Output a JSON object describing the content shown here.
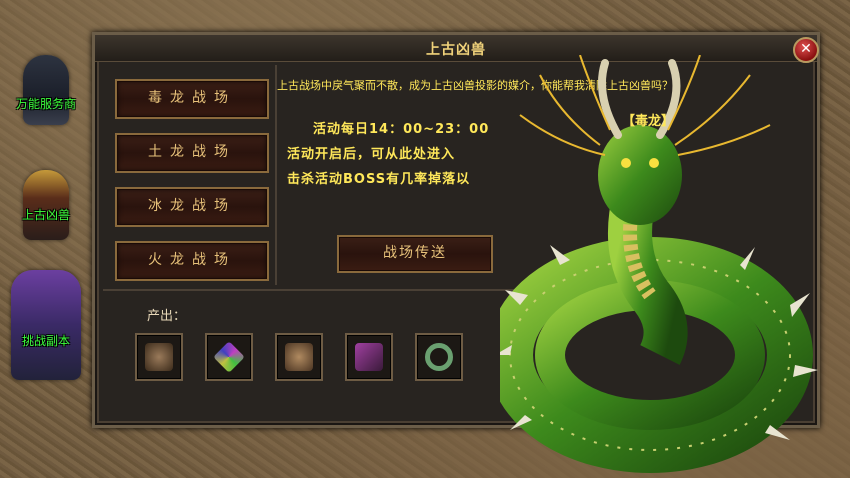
{
  "npcs": [
    {
      "label": "万能服务商"
    },
    {
      "label": "上古凶兽"
    },
    {
      "label": "挑战副本"
    }
  ],
  "dialog": {
    "title": "上古凶兽",
    "close_symbol": "✕",
    "description": "上古战场中戾气聚而不散，成为上古凶兽投影的媒介，你能帮我清除上古凶兽吗？",
    "schedule": "活动每日14：00~23：00",
    "line2": "活动开启后，可从此处进入",
    "line3": "击杀活动BOSS有几率掉落以",
    "teleport_label": "战场传送",
    "boss_name": "【毒龙】",
    "output_label": "产出：",
    "battle_buttons": [
      "毒龙战场",
      "土龙战场",
      "冰龙战场",
      "火龙战场"
    ],
    "output_items": [
      {
        "icon": "helmet-icon",
        "color": "#7a5a3a"
      },
      {
        "icon": "gem-icon",
        "color": "#9a3aa0"
      },
      {
        "icon": "armor-icon",
        "color": "#8a6a4a"
      },
      {
        "icon": "chest-icon",
        "color": "#6a2a6a"
      },
      {
        "icon": "ring-icon",
        "color": "#3a7a4a"
      }
    ]
  },
  "colors": {
    "accent_text": "#ffe85a",
    "npc_label": "#3cff3c",
    "title": "#f0d27a"
  }
}
